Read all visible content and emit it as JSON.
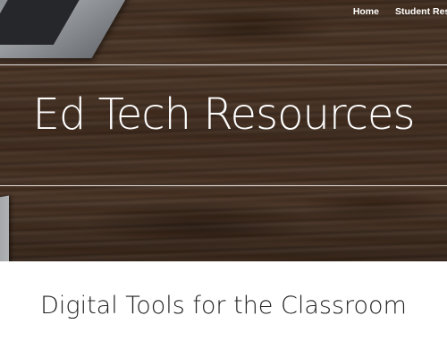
{
  "nav": {
    "items": [
      {
        "label": "Home"
      },
      {
        "label": "Student Resou"
      }
    ]
  },
  "hero": {
    "title": "Ed Tech Resources"
  },
  "content": {
    "subtitle": "Digital Tools for the Classroom"
  },
  "colors": {
    "nav_text": "#ffffff",
    "hero_title": "#ffffff",
    "subtitle": "#222222",
    "page_background": "#ffffff"
  }
}
